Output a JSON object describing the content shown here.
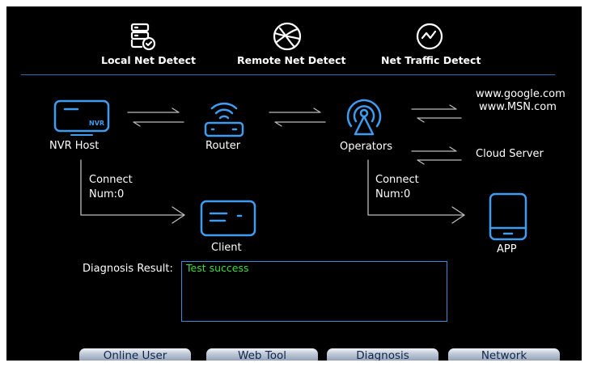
{
  "tabs": [
    {
      "label": "Local Net Detect",
      "icon": "local-net-detect-icon"
    },
    {
      "label": "Remote Net Detect",
      "icon": "globe-icon"
    },
    {
      "label": "Net Traffic Detect",
      "icon": "traffic-chart-icon"
    }
  ],
  "diagram": {
    "nvr_badge": "NVR",
    "nvr_host": "NVR Host",
    "router": "Router",
    "operators": "Operators",
    "client": "Client",
    "app": "APP",
    "sites": [
      "www.google.com",
      "www.MSN.com"
    ],
    "cloud_server": "Cloud Server",
    "left_connect": "Connect\nNum:0",
    "right_connect": "Connect\nNum:0"
  },
  "diagnosis": {
    "label": "Diagnosis Result:",
    "result": "Test success"
  },
  "buttons": {
    "online_user": "Online User",
    "web_tool": "Web Tool",
    "diagnosis": "Diagnosis",
    "network": "Network"
  },
  "colors": {
    "accent": "#3f9cf0",
    "success": "#3ddc3d",
    "background": "#000000"
  }
}
